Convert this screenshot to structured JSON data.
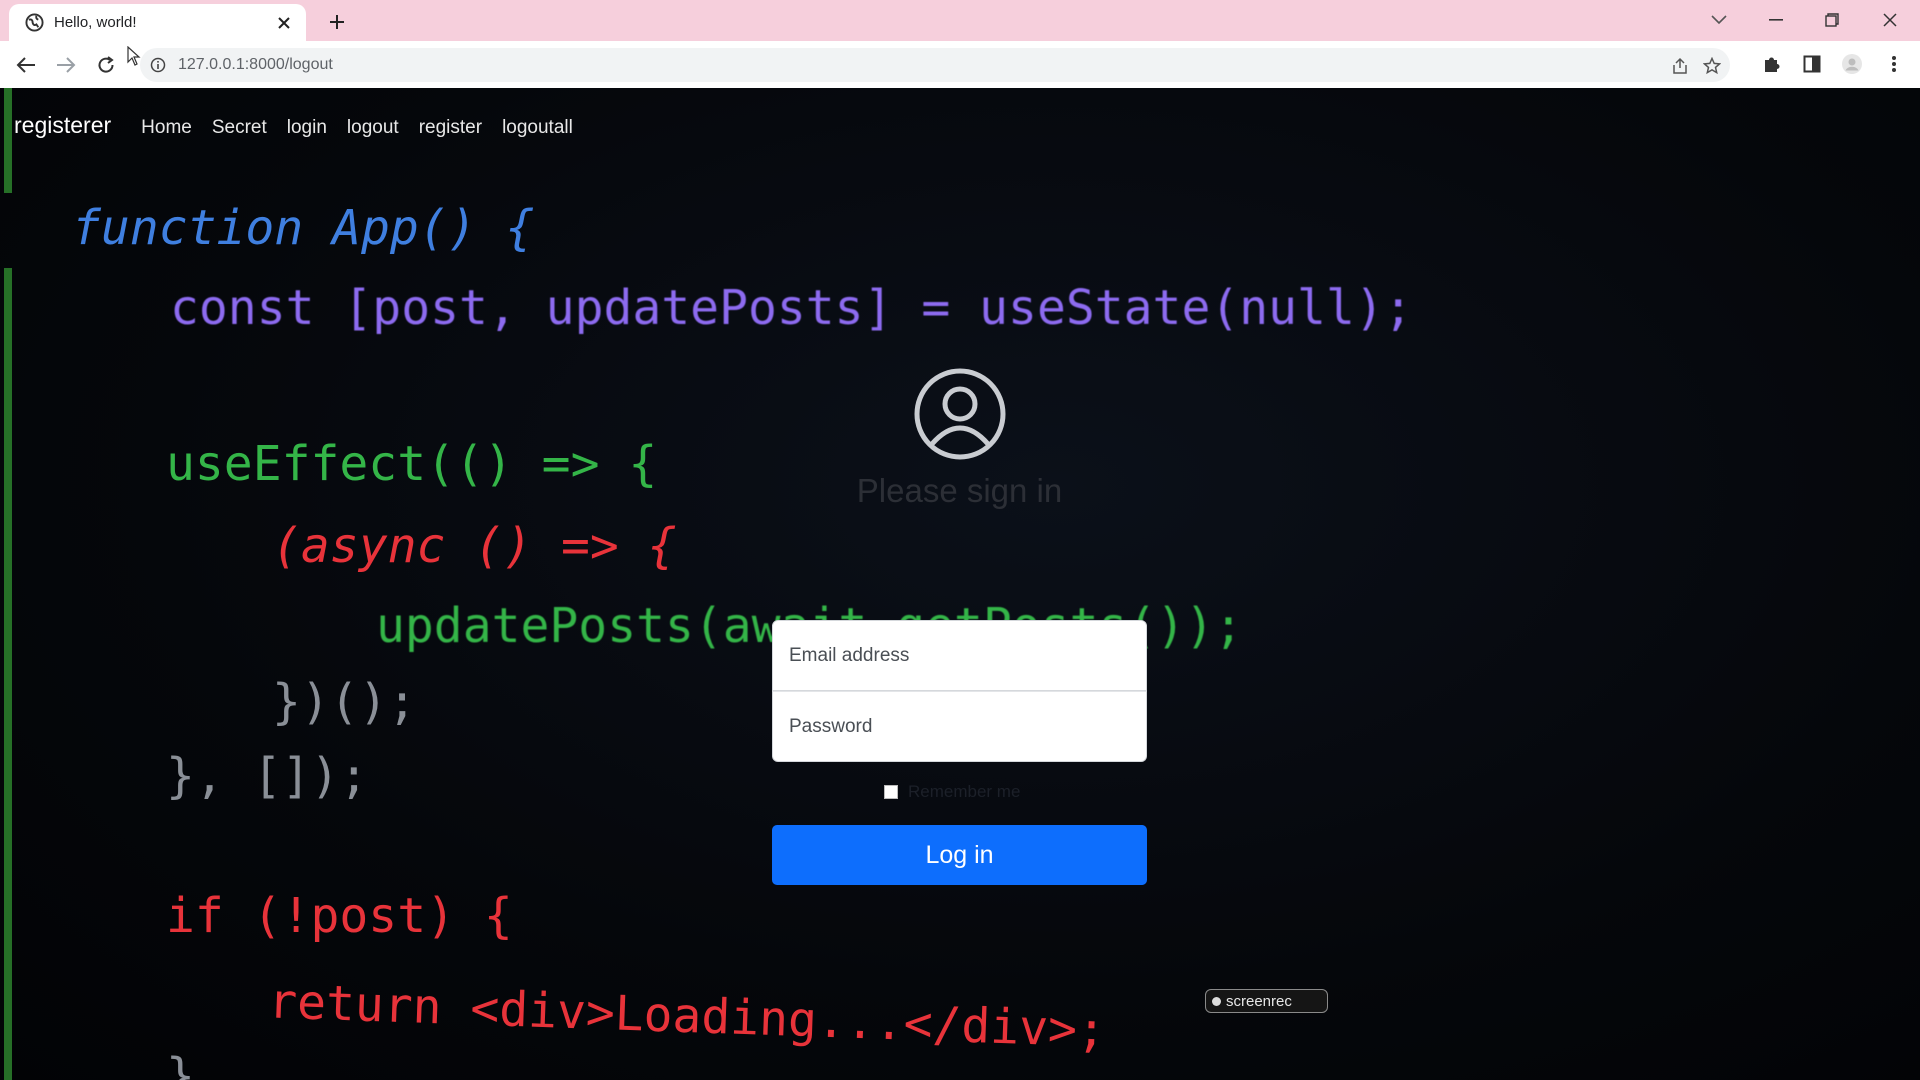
{
  "browser": {
    "tab_title": "Hello, world!",
    "url": "127.0.0.1:8000/logout"
  },
  "navbar": {
    "brand": "registerer",
    "links": [
      "Home",
      "Secret",
      "login",
      "logout",
      "register",
      "logoutall"
    ]
  },
  "signin": {
    "title": "Please sign in",
    "email_placeholder": "Email address",
    "password_placeholder": "Password",
    "remember_label": "Remember me",
    "login_label": "Log in"
  },
  "background_code": [
    "function App() {",
    "const [post, updatePosts] = useState(null);",
    "useEffect(() => {",
    "(async () => {",
    "updatePosts(await getPosts());",
    "})();",
    "}, []);",
    "if (!post) {",
    "return <div>Loading...</div>;",
    "}"
  ],
  "watermark": {
    "label": "screenrec"
  },
  "colors": {
    "primary": "#0d6efd",
    "tabbar": "#f6cfdc"
  },
  "icons": {
    "favicon": "globe-icon",
    "tab_close": "close-icon",
    "new_tab": "plus-icon",
    "back": "back-arrow-icon",
    "forward": "forward-arrow-icon",
    "reload": "reload-icon",
    "site_info": "info-icon",
    "share": "share-icon",
    "bookmark": "star-icon",
    "extensions": "puzzle-icon",
    "side_panel": "side-panel-icon",
    "profile": "profile-icon",
    "menu": "kebab-menu-icon",
    "user": "user-circle-icon"
  }
}
